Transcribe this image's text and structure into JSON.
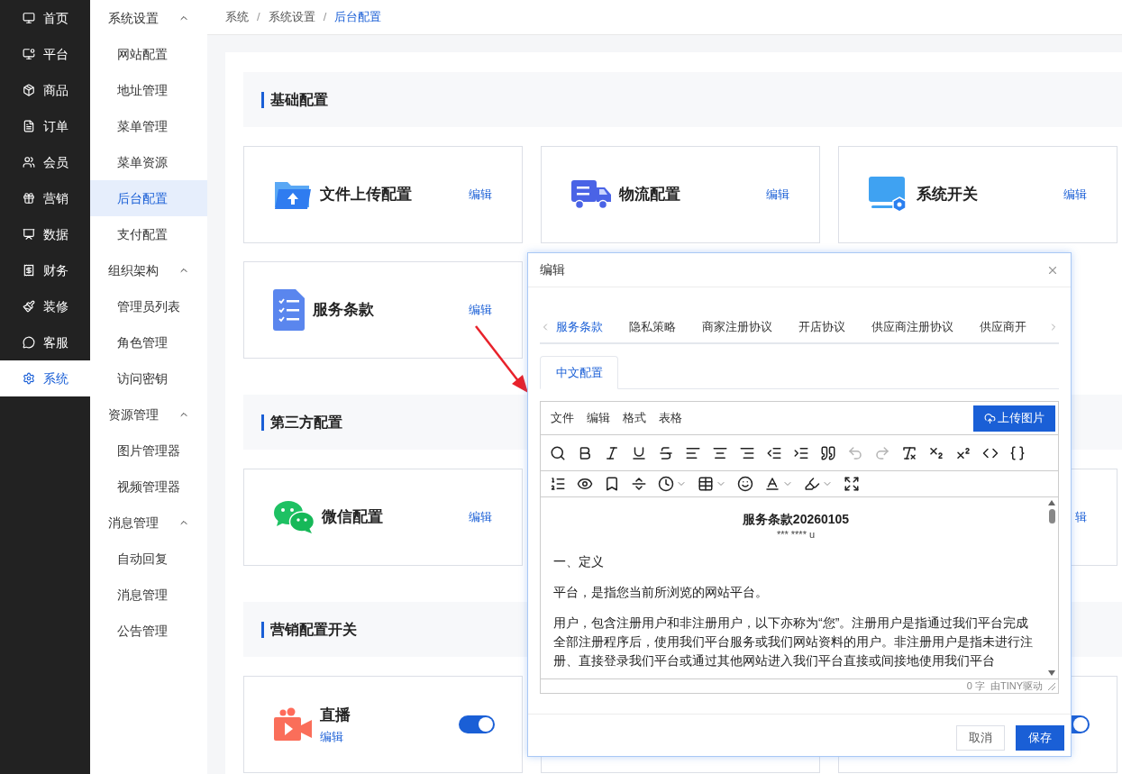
{
  "nav": [
    {
      "label": "首页",
      "selected": false
    },
    {
      "label": "平台",
      "selected": false
    },
    {
      "label": "商品",
      "selected": false
    },
    {
      "label": "订单",
      "selected": false
    },
    {
      "label": "会员",
      "selected": false
    },
    {
      "label": "营销",
      "selected": false
    },
    {
      "label": "数据",
      "selected": false
    },
    {
      "label": "财务",
      "selected": false
    },
    {
      "label": "装修",
      "selected": false
    },
    {
      "label": "客服",
      "selected": false
    },
    {
      "label": "系统",
      "selected": true
    }
  ],
  "submenu": [
    {
      "label": "系统设置",
      "expanded": true,
      "children": [
        {
          "label": "网站配置",
          "selected": false
        },
        {
          "label": "地址管理",
          "selected": false
        },
        {
          "label": "菜单管理",
          "selected": false
        },
        {
          "label": "菜单资源",
          "selected": false
        },
        {
          "label": "后台配置",
          "selected": true
        },
        {
          "label": "支付配置",
          "selected": false
        }
      ]
    },
    {
      "label": "组织架构",
      "expanded": true,
      "children": [
        {
          "label": "管理员列表",
          "selected": false
        },
        {
          "label": "角色管理",
          "selected": false
        },
        {
          "label": "访问密钥",
          "selected": false
        }
      ]
    },
    {
      "label": "资源管理",
      "expanded": true,
      "children": [
        {
          "label": "图片管理器",
          "selected": false
        },
        {
          "label": "视频管理器",
          "selected": false
        }
      ]
    },
    {
      "label": "消息管理",
      "expanded": true,
      "children": [
        {
          "label": "自动回复",
          "selected": false
        },
        {
          "label": "消息管理",
          "selected": false
        },
        {
          "label": "公告管理",
          "selected": false
        }
      ]
    }
  ],
  "breadcrumb": [
    {
      "label": "系统"
    },
    {
      "separator": "/",
      "label": "系统设置"
    },
    {
      "separator": "/",
      "label": "后台配置"
    }
  ],
  "sections": [
    {
      "title": "基础配置",
      "cards": [
        {
          "kind": "link",
          "title": "文件上传配置",
          "edit": "编辑"
        },
        {
          "kind": "link",
          "title": "物流配置",
          "edit": "编辑"
        },
        {
          "kind": "link",
          "title": "系统开关",
          "edit": "编辑"
        },
        {
          "kind": "link",
          "title": "服务条款",
          "edit": "编辑"
        }
      ]
    },
    {
      "title": "第三方配置",
      "cards": [
        {
          "kind": "link",
          "title": "微信配置",
          "edit": "编辑"
        },
        {
          "kind": "blank"
        },
        {
          "kind": "link",
          "edit": "辑"
        }
      ]
    },
    {
      "title": "营销配置开关",
      "cards": [
        {
          "kind": "toggle",
          "title": "直播",
          "edit": "编辑",
          "on": true
        },
        {
          "kind": "blank"
        },
        {
          "kind": "toggle",
          "on": true
        }
      ]
    }
  ],
  "dialog": {
    "title": "编辑",
    "tabs": [
      {
        "label": "服务条款",
        "selected": true
      },
      {
        "label": "隐私策略",
        "selected": false
      },
      {
        "label": "商家注册协议",
        "selected": false
      },
      {
        "label": "开店协议",
        "selected": false
      },
      {
        "label": "供应商注册协议",
        "selected": false
      },
      {
        "label": "供应商开",
        "selected": false
      }
    ],
    "lang_tabs": [
      {
        "label": "中文配置",
        "selected": true
      }
    ],
    "editor": {
      "menus": [
        "文件",
        "编辑",
        "格式",
        "表格"
      ],
      "upload": "上传图片",
      "history_disabled": true,
      "doc_title": "服务条款20260105",
      "doc_subtitle": "*** **** u",
      "paragraphs": [
        "一、定义",
        "平台，是指您当前所浏览的网站平台。",
        "用户，包含注册用户和非注册用户，以下亦称为“您”。注册用户是指通过我们平台完成全部注册程序后，使用我们平台服务或我们网站资料的用户。非注册用户是指未进行注册、直接登录我们平台或通过其他网站进入我们平台直接或间接地使用我们平台"
      ],
      "word_count": "0 字",
      "powered_by": "由TINY驱动"
    },
    "buttons": [
      {
        "label": "取消",
        "kind": "secondary"
      },
      {
        "label": "保存",
        "kind": "primary"
      }
    ]
  }
}
